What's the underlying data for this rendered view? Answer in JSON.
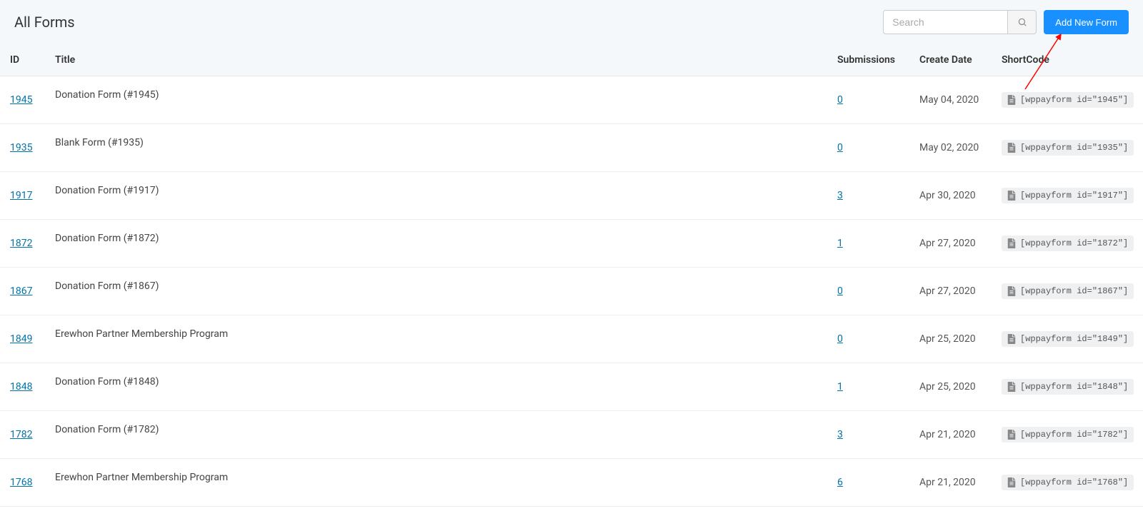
{
  "header": {
    "title": "All Forms",
    "search_placeholder": "Search",
    "add_button_label": "Add New Form"
  },
  "columns": {
    "id": "ID",
    "title": "Title",
    "submissions": "Submissions",
    "create_date": "Create Date",
    "shortcode": "ShortCode"
  },
  "rows": [
    {
      "id": "1945",
      "title": "Donation Form (#1945)",
      "submissions": "0",
      "date": "May 04, 2020",
      "shortcode": "[wppayform id=\"1945\"]"
    },
    {
      "id": "1935",
      "title": "Blank Form (#1935)",
      "submissions": "0",
      "date": "May 02, 2020",
      "shortcode": "[wppayform id=\"1935\"]"
    },
    {
      "id": "1917",
      "title": "Donation Form (#1917)",
      "submissions": "3",
      "date": "Apr 30, 2020",
      "shortcode": "[wppayform id=\"1917\"]"
    },
    {
      "id": "1872",
      "title": "Donation Form (#1872)",
      "submissions": "1",
      "date": "Apr 27, 2020",
      "shortcode": "[wppayform id=\"1872\"]"
    },
    {
      "id": "1867",
      "title": "Donation Form (#1867)",
      "submissions": "0",
      "date": "Apr 27, 2020",
      "shortcode": "[wppayform id=\"1867\"]"
    },
    {
      "id": "1849",
      "title": "Erewhon Partner Membership Program",
      "submissions": "0",
      "date": "Apr 25, 2020",
      "shortcode": "[wppayform id=\"1849\"]"
    },
    {
      "id": "1848",
      "title": "Donation Form (#1848)",
      "submissions": "1",
      "date": "Apr 25, 2020",
      "shortcode": "[wppayform id=\"1848\"]"
    },
    {
      "id": "1782",
      "title": "Donation Form (#1782)",
      "submissions": "3",
      "date": "Apr 21, 2020",
      "shortcode": "[wppayform id=\"1782\"]"
    },
    {
      "id": "1768",
      "title": "Erewhon Partner Membership Program",
      "submissions": "6",
      "date": "Apr 21, 2020",
      "shortcode": "[wppayform id=\"1768\"]"
    }
  ]
}
